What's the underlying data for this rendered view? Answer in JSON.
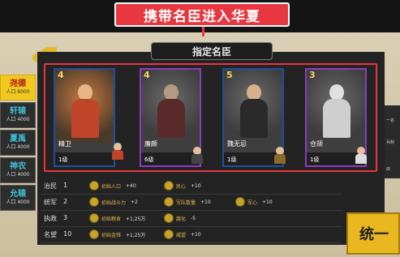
{
  "banner": {
    "text": "携带名臣进入华夏"
  },
  "panel": {
    "title": "指定名臣"
  },
  "sidebar": {
    "items": [
      {
        "name": "尧德",
        "sub": "人口 6000",
        "active": true
      },
      {
        "name": "轩辕",
        "sub": "人口 4000",
        "active": false
      },
      {
        "name": "夏禹",
        "sub": "人口 4000",
        "active": false
      },
      {
        "name": "神农",
        "sub": "人口 4000",
        "active": false
      },
      {
        "name": "允辕",
        "sub": "人口 4000",
        "active": false
      }
    ]
  },
  "cards": [
    {
      "num": "4",
      "name": "精卫",
      "level": "1级",
      "frame": "blue"
    },
    {
      "num": "4",
      "name": "廉颇",
      "level": "6级",
      "frame": "purple"
    },
    {
      "num": "5",
      "name": "魏无忌",
      "level": "1级",
      "frame": "blue"
    },
    {
      "num": "3",
      "name": "仓颉",
      "level": "1级",
      "frame": "purple"
    }
  ],
  "stats": [
    {
      "label": "治民",
      "value": "1",
      "effects": [
        {
          "name": "初始人口",
          "val": "+40"
        },
        {
          "name": "民心",
          "val": "+10"
        }
      ]
    },
    {
      "label": "统军",
      "value": "2",
      "effects": [
        {
          "name": "初始战斗力",
          "val": "+2"
        },
        {
          "name": "军队数量",
          "val": "+10"
        },
        {
          "name": "军心",
          "val": "+10"
        }
      ]
    },
    {
      "label": "执政",
      "value": "3",
      "effects": [
        {
          "name": "初始粮食",
          "val": "+1,25万"
        },
        {
          "name": "腐化",
          "val": "-5"
        }
      ]
    },
    {
      "label": "名望",
      "value": "10",
      "effects": [
        {
          "name": "初始金钱",
          "val": "+1,25万"
        },
        {
          "name": "威望",
          "val": "+10"
        }
      ]
    }
  ],
  "right_side": {
    "line1": "一名",
    "line2": "兵制",
    "line3": "启"
  },
  "unify_button": {
    "label": "统一"
  },
  "colors": {
    "accent_red": "#e8373f",
    "gold": "#e9b71f",
    "card_blue": "#1f4f9e",
    "card_purple": "#8b3dbd"
  }
}
